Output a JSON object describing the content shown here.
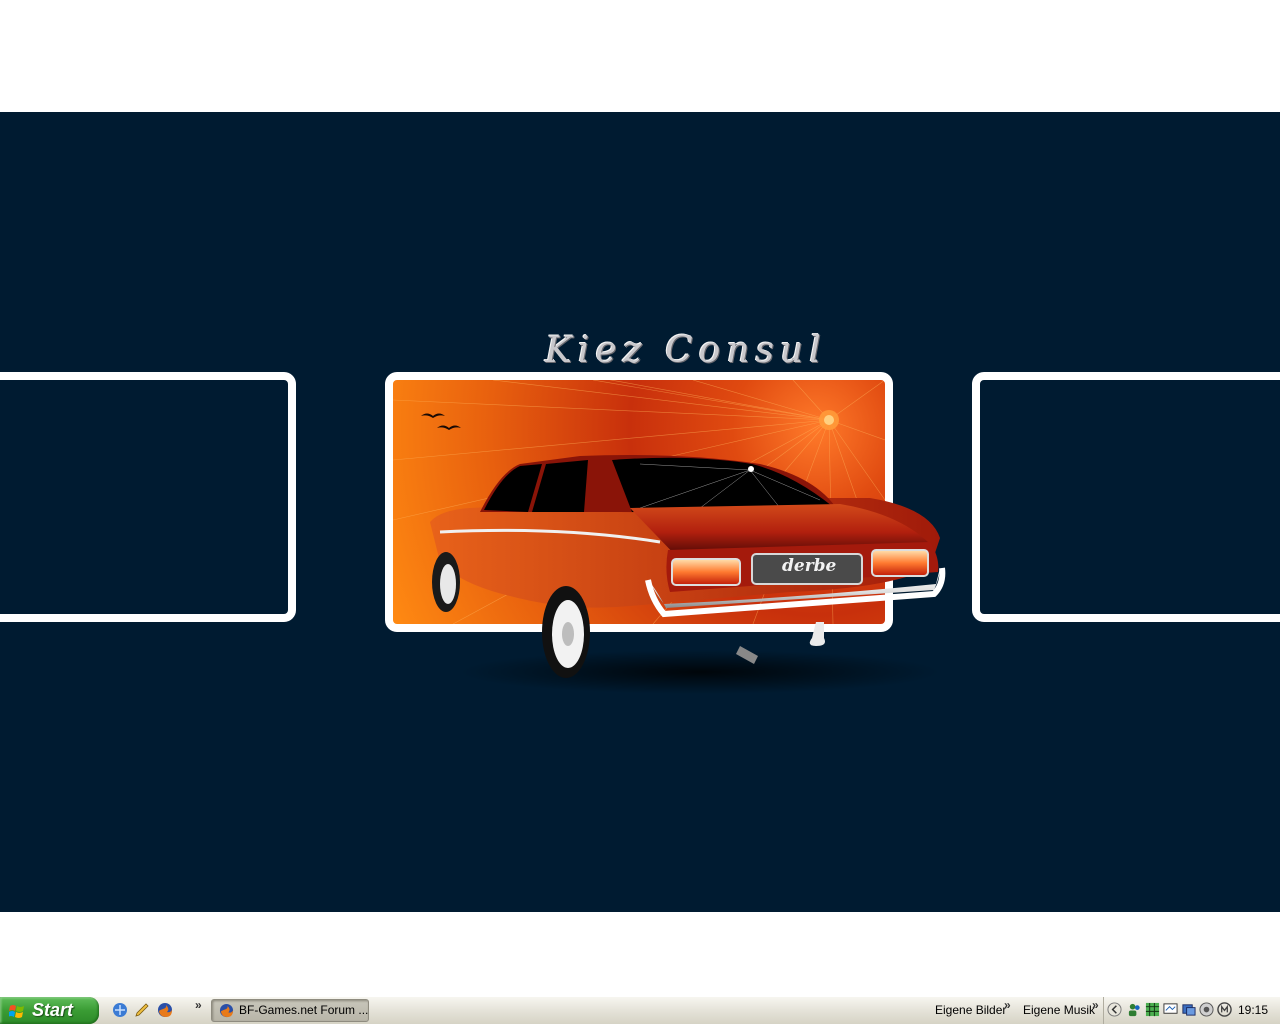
{
  "wallpaper": {
    "title": "Kiez Consul",
    "plate_text": "derbe",
    "background_color": "#001b31"
  },
  "taskbar": {
    "start_label": "Start",
    "quick_launch": [
      "network-icon",
      "pen-icon",
      "firefox-icon"
    ],
    "window_button": {
      "label": "BF-Games.net Forum ...",
      "icon": "firefox-icon"
    },
    "links": [
      "Eigene Bilder",
      "Eigene Musik"
    ],
    "tray_icons": [
      "expand-arrow-icon",
      "users-icon",
      "network-grid-icon",
      "monitor-icon",
      "display-icon",
      "speaker-icon",
      "antivirus-icon"
    ],
    "clock": "19:15"
  }
}
